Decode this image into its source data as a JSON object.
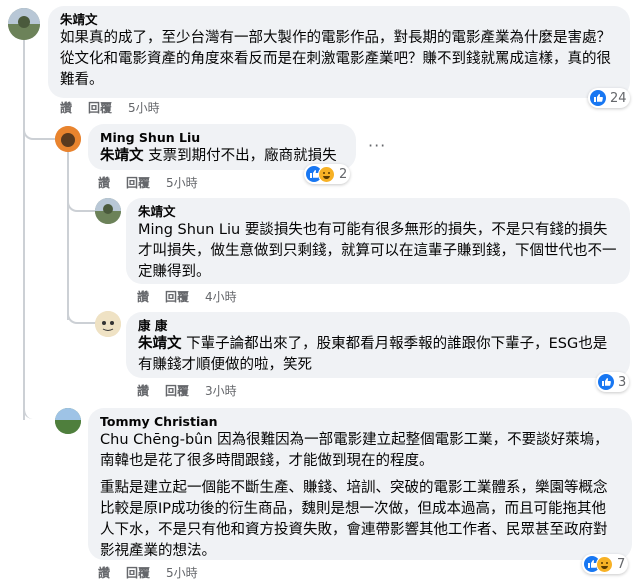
{
  "comments": [
    {
      "name": "朱靖文",
      "text": "如果真的成了，至少台灣有一部大製作的電影作品，對長期的電影產業為什麼是害處？從文化和電影資產的角度來看反而是在刺激電影產業吧？賺不到錢就罵成這樣，真的很難看。",
      "like": "讚",
      "reply": "回覆",
      "time": "5小時",
      "reactions": "24"
    },
    {
      "name": "Ming Shun Liu",
      "tag": "朱靖文",
      "text": " 支票到期付不出，廠商就損失",
      "like": "讚",
      "reply": "回覆",
      "time": "5小時",
      "reactions": "2",
      "more": "···"
    },
    {
      "name": "朱靖文",
      "tag": "Ming Shun Liu",
      "text": " 要談損失也有可能有很多無形的損失，不是只有錢的損失才叫損失，做生意做到只剩錢，就算可以在這輩子賺到錢，下個世代也不一定賺得到。",
      "like": "讚",
      "reply": "回覆",
      "time": "4小時"
    },
    {
      "name": "康 康",
      "tag": "朱靖文",
      "text": " 下輩子論都出來了，股東都看月報季報的誰跟你下輩子，ESG也是有賺錢才順便做的啦，笑死",
      "like": "讚",
      "reply": "回覆",
      "time": "3小時",
      "reactions": "3"
    },
    {
      "name": "Tommy Christian",
      "tag": "Chu Chēng-bûn",
      "text": " 因為很難因為一部電影建立起整個電影工業，不要談好萊塢，南韓也是花了很多時間跟錢，才能做到現在的程度。",
      "text2": "重點是建立起一個能不斷生產、賺錢、培訓、突破的電影工業體系，樂園等概念比較是原IP成功後的衍生商品，魏則是想一次做，但成本過高，而且可能拖其他人下水，不是只有他和資方投資失敗，會連帶影響其他工作者、民眾甚至政府對影視產業的想法。",
      "like": "讚",
      "reply": "回覆",
      "time": "5小時",
      "reactions": "7"
    }
  ],
  "colors": {
    "like_blue": "#1877f2",
    "haha_yellow": "#f7b125",
    "bubble": "#f0f2f5",
    "meta": "#65676b"
  }
}
